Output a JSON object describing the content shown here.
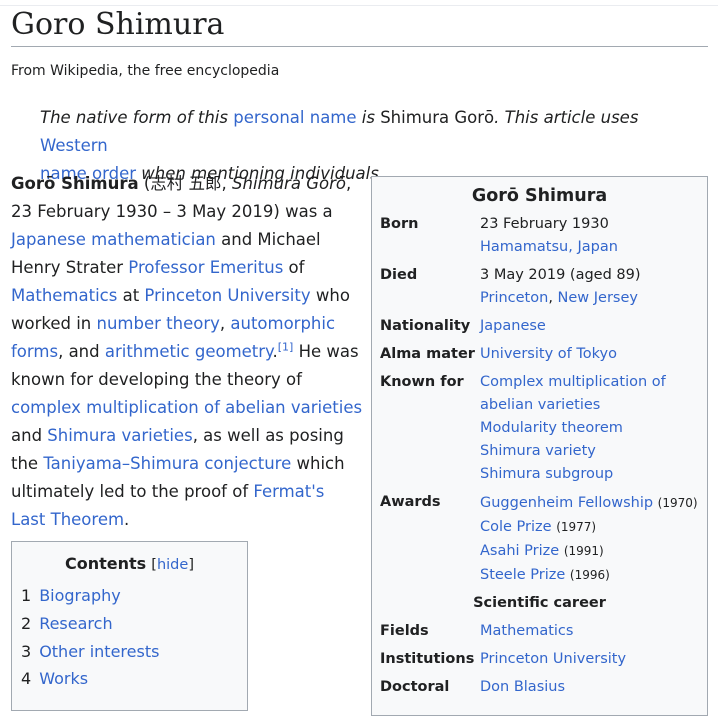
{
  "title": "Goro Shimura",
  "tagline": "From Wikipedia, the free encyclopedia",
  "hatnote": {
    "p1": "The native form of this ",
    "link1": "personal name",
    "p2": " is ",
    "name": "Shimura Gorō",
    "p3": ". This article uses ",
    "link2a": "Western",
    "link2b": "name order",
    "p4": " when mentioning individuals."
  },
  "lead": {
    "bold_name": "Gorō Shimura",
    "native": " (志村 五郎, ",
    "romanized": "Shimura Gorō",
    "dates": ", 23 February 1930 – 3 May 2019) was a ",
    "link_japanese_math": "Japanese mathematician",
    "t1": " and Michael Henry Strater ",
    "link_prof_emeritus": "Professor Emeritus",
    "t2": " of ",
    "link_mathematics": "Mathematics",
    "t3": " at ",
    "link_princeton": "Princeton University",
    "t4": " who worked in ",
    "link_number_theory": "number theory",
    "t5": ", ",
    "link_automorphic": "automorphic forms",
    "t6": ", and ",
    "link_arith_geom": "arithmetic geometry",
    "t7": ".",
    "ref": "[1]",
    "t8": " He was known for developing the theory of ",
    "link_cm_abelian": "complex multiplication of abelian varieties",
    "t9": " and ",
    "link_shimura_varieties": "Shimura varieties",
    "t10": ", as well as posing the ",
    "link_taniyama": "Taniyama–Shimura conjecture",
    "t11": " which ultimately led to the proof of ",
    "link_fermat": "Fermat's Last Theorem",
    "t12": "."
  },
  "infobox": {
    "title": "Gorō Shimura",
    "born_label": "Born",
    "born_date": "23 February 1930",
    "born_place": "Hamamatsu, Japan",
    "died_label": "Died",
    "died_date": "3 May 2019 (aged 89)",
    "died_city": "Princeton",
    "died_sep": ", ",
    "died_state": "New Jersey",
    "nationality_label": "Nationality",
    "nationality": "Japanese",
    "alma_label": "Alma mater",
    "alma": "University of Tokyo",
    "known_label": "Known for",
    "known": [
      "Complex multiplication of",
      "abelian varieties",
      "Modularity theorem",
      "Shimura variety",
      "Shimura subgroup"
    ],
    "awards_label": "Awards",
    "awards": [
      {
        "name": "Guggenheim Fellowship",
        "year": "(1970)"
      },
      {
        "name": "Cole Prize",
        "year": "(1977)"
      },
      {
        "name": "Asahi Prize",
        "year": "(1991)"
      },
      {
        "name": "Steele Prize",
        "year": "(1996)"
      }
    ],
    "career_header": "Scientific career",
    "fields_label": "Fields",
    "fields": "Mathematics",
    "institutions_label": "Institutions",
    "institutions": "Princeton University",
    "doctoral_label": "Doctoral",
    "doctoral": "Don Blasius"
  },
  "toc": {
    "title": "Contents",
    "hide_open": "[",
    "hide": "hide",
    "hide_close": "]",
    "items": [
      {
        "num": "1",
        "label": "Biography"
      },
      {
        "num": "2",
        "label": "Research"
      },
      {
        "num": "3",
        "label": "Other interests"
      },
      {
        "num": "4",
        "label": "Works"
      }
    ]
  }
}
